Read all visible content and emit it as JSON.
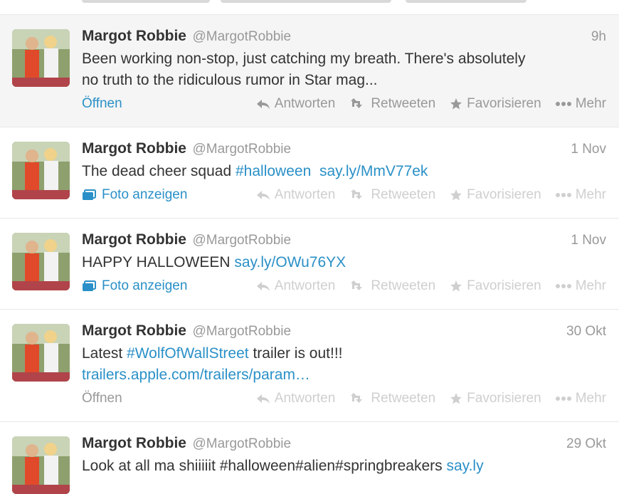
{
  "tweets": [
    {
      "name": "Margot Robbie",
      "handle": "@MargotRobbie",
      "time": "9h",
      "text_lines": [
        "Been working non-stop, just catching my breath. There's absolutely",
        "no truth to the ridiculous rumor in Star mag..."
      ],
      "expand": "Öffnen"
    },
    {
      "name": "Margot Robbie",
      "handle": "@MargotRobbie",
      "time": "1 Nov",
      "text": "The dead cheer squad ",
      "hashtag": "#halloween",
      "link": "say.ly/MmV77ek",
      "expand": "Foto anzeigen"
    },
    {
      "name": "Margot Robbie",
      "handle": "@MargotRobbie",
      "time": "1 Nov",
      "text": "HAPPY HALLOWEEN ",
      "link": "say.ly/OWu76YX",
      "expand": "Foto anzeigen"
    },
    {
      "name": "Margot Robbie",
      "handle": "@MargotRobbie",
      "time": "30 Okt",
      "text_a": "Latest ",
      "hashtag": "#WolfOfWallStreet",
      "text_b": " trailer is out!!!",
      "link": "trailers.apple.com/trailers/param…",
      "expand": "Öffnen"
    },
    {
      "name": "Margot Robbie",
      "handle": "@MargotRobbie",
      "time": "29 Okt",
      "text": "Look at all ma shiiiiit #halloween#alien#springbreakers ",
      "link": "say.ly"
    }
  ],
  "actions": {
    "reply": "Antworten",
    "retweet": "Retweeten",
    "favorite": "Favorisieren",
    "more": "Mehr"
  },
  "colors": {
    "link": "#2a90c7",
    "hover_bg": "#f5f5f5",
    "muted": "#999999",
    "faded": "#cfcfcf"
  },
  "icons": [
    "reply-icon",
    "retweet-icon",
    "star-icon",
    "more-dots-icon",
    "photo-icon"
  ]
}
